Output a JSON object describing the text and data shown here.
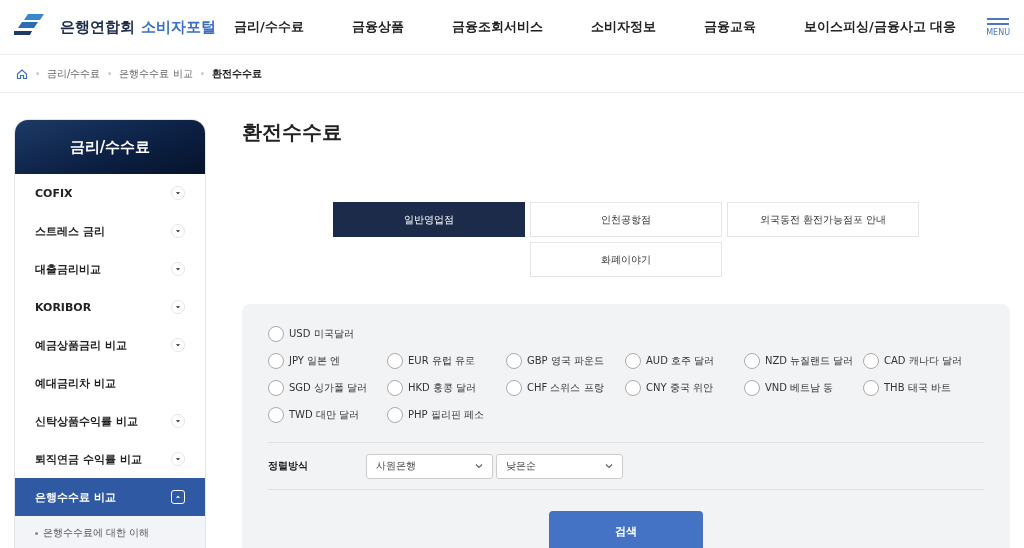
{
  "header": {
    "logo_org": "은행연합회",
    "logo_portal": "소비자포털",
    "nav": [
      "금리/수수료",
      "금융상품",
      "금융조회서비스",
      "소비자정보",
      "금융교육",
      "보이스피싱/금융사고 대응"
    ],
    "menu_label": "MENU"
  },
  "breadcrumb": [
    "금리/수수료",
    "은행수수료 비교",
    "환전수수료"
  ],
  "sidebar": {
    "title": "금리/수수료",
    "items": [
      {
        "label": "COFIX",
        "kind": "submenu",
        "selected": false,
        "expanded": false
      },
      {
        "label": "스트레스 금리",
        "kind": "submenu",
        "selected": false,
        "expanded": false
      },
      {
        "label": "대출금리비교",
        "kind": "submenu",
        "selected": false,
        "expanded": false
      },
      {
        "label": "KORIBOR",
        "kind": "submenu",
        "selected": false,
        "expanded": false
      },
      {
        "label": "예금상품금리 비교",
        "kind": "submenu",
        "selected": false,
        "expanded": false
      },
      {
        "label": "예대금리차 비교",
        "kind": "link",
        "selected": false
      },
      {
        "label": "신탁상품수익률 비교",
        "kind": "submenu",
        "selected": false,
        "expanded": false
      },
      {
        "label": "퇴직연금 수익률 비교",
        "kind": "submenu",
        "selected": false,
        "expanded": false
      },
      {
        "label": "은행수수료 비교",
        "kind": "submenu",
        "selected": true,
        "expanded": true,
        "children": [
          {
            "label": "은행수수료에 대한 이해"
          }
        ]
      }
    ]
  },
  "page_title": "환전수수료",
  "tabs": [
    {
      "label": "일반영업점",
      "selected": true
    },
    {
      "label": "인천공항점",
      "selected": false
    },
    {
      "label": "외국동전 환전가능점포 안내",
      "selected": false
    },
    {
      "label": "화폐이야기",
      "selected": false
    }
  ],
  "currency_rows": [
    [
      {
        "label": "USD 미국달러",
        "selected": false
      }
    ],
    [
      {
        "label": "JPY 일본 엔",
        "selected": false
      },
      {
        "label": "EUR 유럽 유로",
        "selected": false
      },
      {
        "label": "GBP 영국 파운드",
        "selected": false
      },
      {
        "label": "AUD 호주 달러",
        "selected": false
      },
      {
        "label": "NZD 뉴질랜드 달러",
        "selected": false
      },
      {
        "label": "CAD 캐나다 달러",
        "selected": false
      }
    ],
    [
      {
        "label": "SGD 싱가폴 달러",
        "selected": false
      },
      {
        "label": "HKD 홍콩 달러",
        "selected": false
      },
      {
        "label": "CHF 스위스 프랑",
        "selected": false
      },
      {
        "label": "CNY 중국 위안",
        "selected": false
      },
      {
        "label": "VND 베트남 동",
        "selected": false
      },
      {
        "label": "THB 태국 바트",
        "selected": false
      }
    ],
    [
      {
        "label": "TWD 대만 달러",
        "selected": false
      },
      {
        "label": "PHP 필리핀 페소",
        "selected": false
      }
    ]
  ],
  "sort": {
    "label": "정렬방식",
    "selects": [
      "사원은행",
      "낮은순"
    ]
  },
  "search_button": "검색"
}
